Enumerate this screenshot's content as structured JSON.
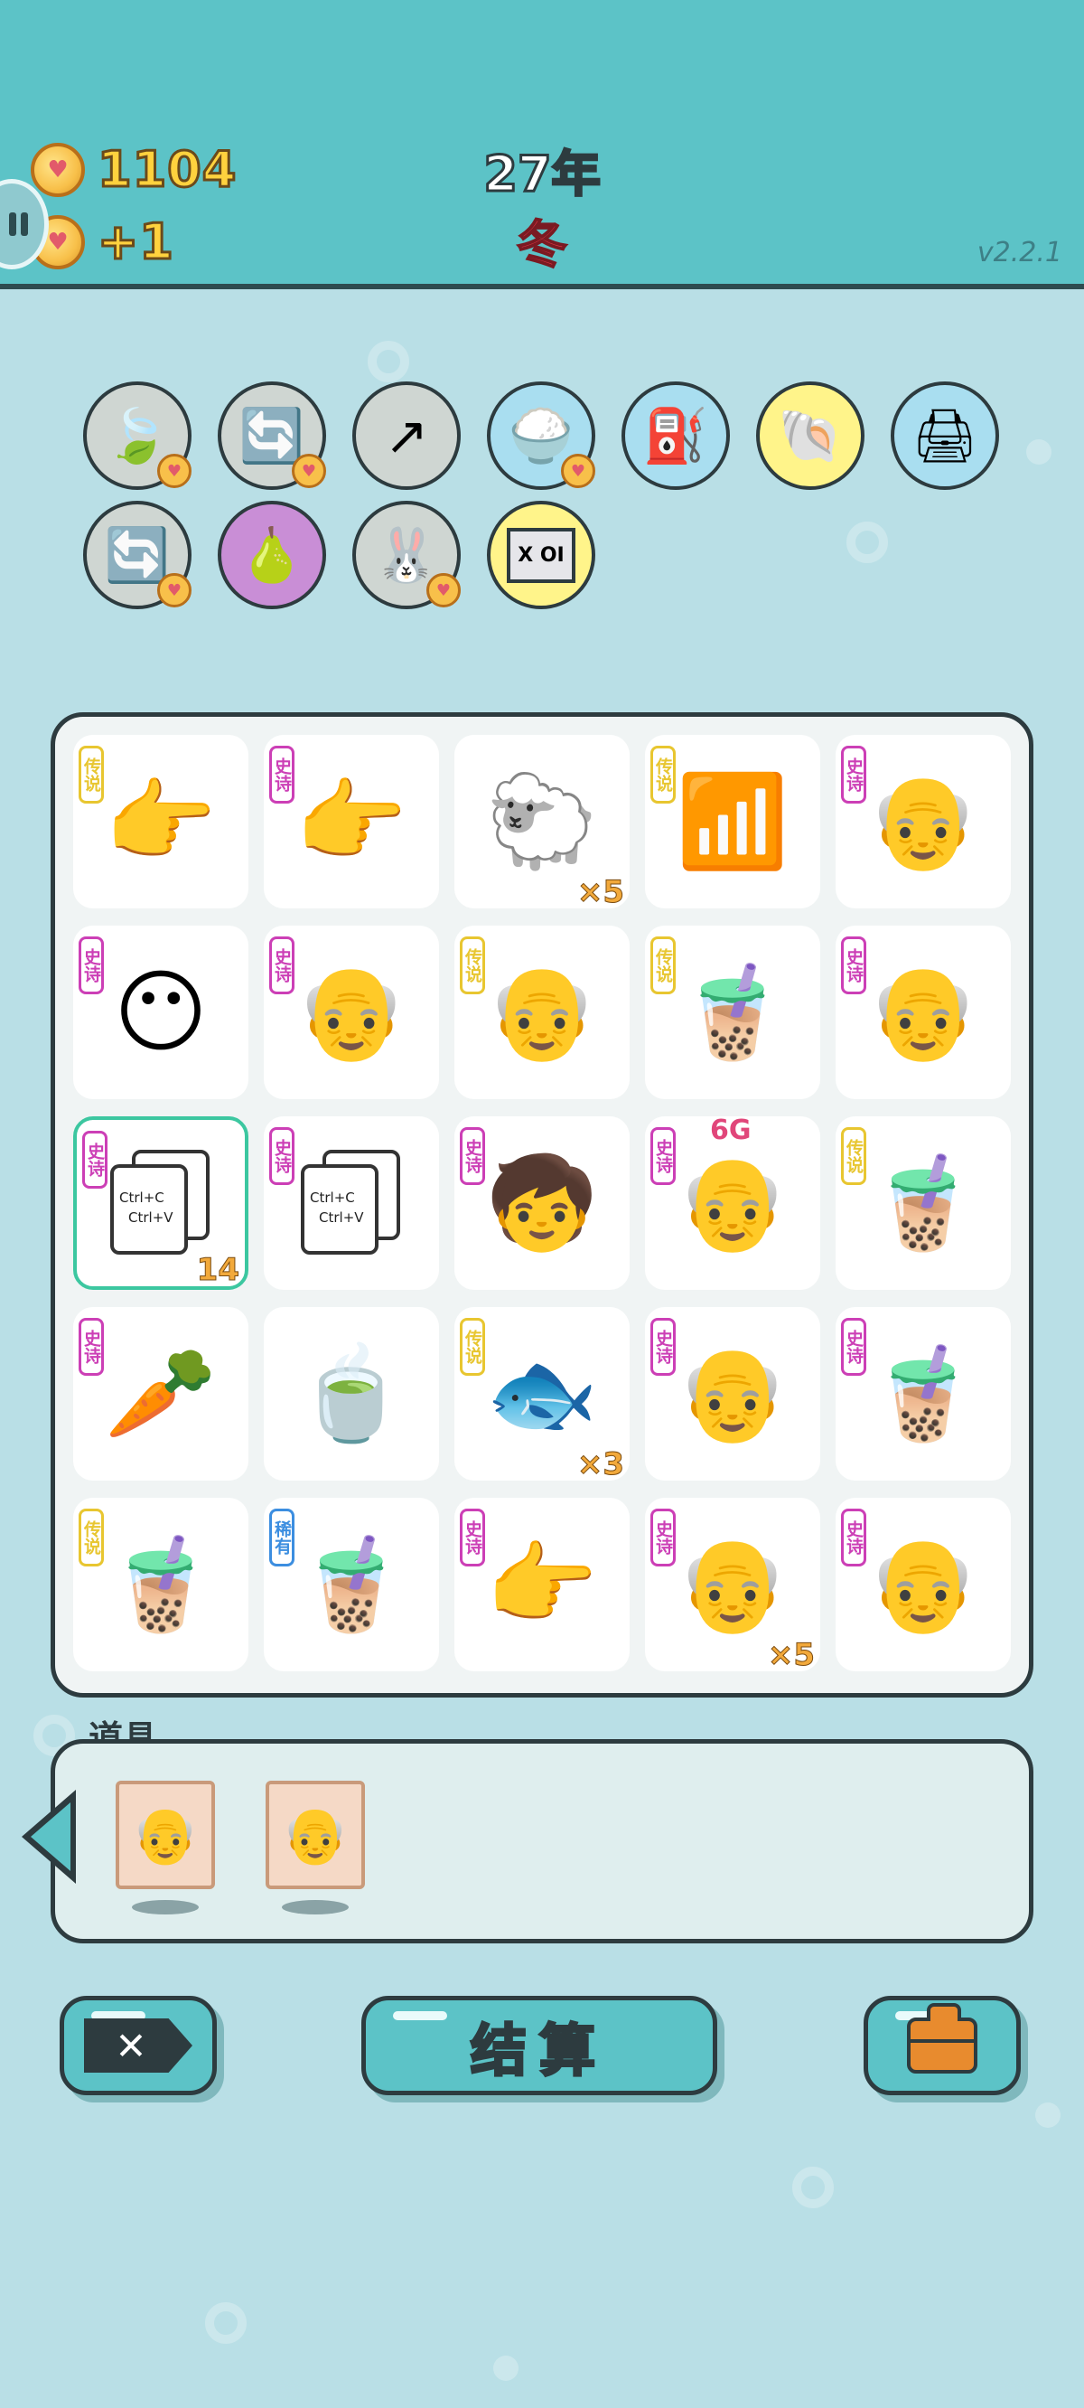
{
  "header": {
    "gold": "1104",
    "income": "+1",
    "year": "27年",
    "season": "冬",
    "version": "v2.2.1"
  },
  "relics": [
    {
      "name": "leaf-icon",
      "glyph": "🍃",
      "bg": "#cfd6d2",
      "heart": true
    },
    {
      "name": "refresh-icon",
      "glyph": "🔄",
      "bg": "#cfd6d2",
      "heart": true
    },
    {
      "name": "trend-arrow-icon",
      "glyph": "↗",
      "bg": "#cfd6d2",
      "heart": false
    },
    {
      "name": "rice-bowl-icon",
      "glyph": "🍚",
      "bg": "#a9def0",
      "heart": true
    },
    {
      "name": "air-pump-icon",
      "glyph": "⛽",
      "bg": "#a9def0",
      "heart": false
    },
    {
      "name": "shell-icon",
      "glyph": "🐚",
      "bg": "#fff48a",
      "heart": false
    },
    {
      "name": "printer-icon",
      "glyph": "🖨",
      "bg": "#a9def0",
      "heart": false
    },
    {
      "name": "refresh-icon-2",
      "glyph": "🔄",
      "bg": "#cfd6d2",
      "heart": true
    },
    {
      "name": "grapefruit-icon",
      "glyph": "🍐",
      "bg": "#c98ed6",
      "heart": false
    },
    {
      "name": "rabbit-icon",
      "glyph": "🐰",
      "bg": "#cfd6d2",
      "heart": true
    },
    {
      "name": "chip-icon",
      "glyph": "X OI",
      "bg": "#fff48a",
      "heart": false
    }
  ],
  "rarity_colors": {
    "传说": "#e8c630",
    "史诗": "#cc3fb6",
    "稀有": "#3c8ee0"
  },
  "grid": [
    {
      "name": "pointing-hand-gold",
      "rarity": "传说",
      "glyph": "👉",
      "count": ""
    },
    {
      "name": "pointing-hand-gray",
      "rarity": "史诗",
      "glyph": "👉",
      "count": ""
    },
    {
      "name": "sheep",
      "rarity": "",
      "glyph": "🐑",
      "count": "×5"
    },
    {
      "name": "wifi",
      "rarity": "传说",
      "glyph": "📶",
      "count": ""
    },
    {
      "name": "old-man",
      "rarity": "史诗",
      "glyph": "👴",
      "count": ""
    },
    {
      "name": "yellow-face",
      "rarity": "史诗",
      "glyph": "😶",
      "count": ""
    },
    {
      "name": "old-man",
      "rarity": "史诗",
      "glyph": "👴",
      "count": ""
    },
    {
      "name": "old-man-grinning",
      "rarity": "传说",
      "glyph": "👴",
      "count": ""
    },
    {
      "name": "bubble-tea-dome",
      "rarity": "传说",
      "glyph": "🧋",
      "count": ""
    },
    {
      "name": "old-man",
      "rarity": "史诗",
      "glyph": "👴",
      "count": ""
    },
    {
      "name": "ctrl-c-ctrl-v",
      "rarity": "史诗",
      "glyph": "ctrl",
      "count": "14",
      "selected": true
    },
    {
      "name": "ctrl-c-ctrl-v",
      "rarity": "史诗",
      "glyph": "ctrl",
      "count": ""
    },
    {
      "name": "red-cap-boy",
      "rarity": "史诗",
      "glyph": "🧒",
      "count": ""
    },
    {
      "name": "old-man-6g",
      "rarity": "史诗",
      "glyph": "👴",
      "count": "",
      "badge": "6G"
    },
    {
      "name": "bubble-tea-dome",
      "rarity": "传说",
      "glyph": "🧋",
      "count": ""
    },
    {
      "name": "carrot",
      "rarity": "史诗",
      "glyph": "🥕",
      "count": ""
    },
    {
      "name": "tea-bag",
      "rarity": "",
      "glyph": "🍵",
      "count": ""
    },
    {
      "name": "koi-fish",
      "rarity": "传说",
      "glyph": "🐟",
      "count": "×3"
    },
    {
      "name": "old-man",
      "rarity": "史诗",
      "glyph": "👴",
      "count": ""
    },
    {
      "name": "bubble-tea-tall",
      "rarity": "史诗",
      "glyph": "🧋",
      "count": ""
    },
    {
      "name": "bubble-tea-dome",
      "rarity": "传说",
      "glyph": "🧋",
      "count": ""
    },
    {
      "name": "bubble-tea-small",
      "rarity": "稀有",
      "glyph": "🧋",
      "count": ""
    },
    {
      "name": "pointing-hand-gray",
      "rarity": "史诗",
      "glyph": "👉",
      "count": ""
    },
    {
      "name": "old-man",
      "rarity": "史诗",
      "glyph": "👴",
      "count": "×5"
    },
    {
      "name": "old-man",
      "rarity": "史诗",
      "glyph": "👴",
      "count": ""
    }
  ],
  "props": {
    "title": "道具",
    "items": [
      {
        "name": "old-man-portrait",
        "glyph": "👴"
      },
      {
        "name": "old-man-portrait",
        "glyph": "👴"
      }
    ]
  },
  "ctrl_text": {
    "line1": "Ctrl+C",
    "line2": "Ctrl+V"
  },
  "buttons": {
    "discard_glyph": "✕",
    "settle": "结算"
  }
}
